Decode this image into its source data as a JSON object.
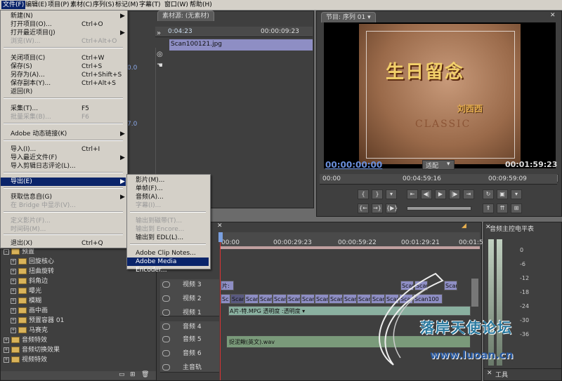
{
  "menubar": {
    "items": [
      "文件(F)",
      "编辑(E)",
      "项目(P)",
      "素材(C)",
      "序列(S)",
      "标记(M)",
      "字幕(T)",
      "窗口(W)",
      "帮助(H)"
    ]
  },
  "file_menu": {
    "items": [
      {
        "label": "新建(N)",
        "shortcut": "",
        "arrow": "▶",
        "disabled": false
      },
      {
        "label": "打开项目(O)...",
        "shortcut": "Ctrl+O",
        "arrow": "",
        "disabled": false
      },
      {
        "label": "打开最近项目(J)",
        "shortcut": "",
        "arrow": "▶",
        "disabled": false
      },
      {
        "label": "浏览(W)...",
        "shortcut": "Ctrl+Alt+O",
        "arrow": "",
        "disabled": true
      },
      {
        "label": "关闭项目(C)",
        "shortcut": "Ctrl+W",
        "arrow": "",
        "disabled": false
      },
      {
        "label": "保存(S)",
        "shortcut": "Ctrl+S",
        "arrow": "",
        "disabled": false
      },
      {
        "label": "另存为(A)...",
        "shortcut": "Ctrl+Shift+S",
        "arrow": "",
        "disabled": false
      },
      {
        "label": "保存副本(Y)...",
        "shortcut": "Ctrl+Alt+S",
        "arrow": "",
        "disabled": false
      },
      {
        "label": "返回(R)",
        "shortcut": "",
        "arrow": "",
        "disabled": false
      },
      {
        "label": "采集(T)...",
        "shortcut": "F5",
        "arrow": "",
        "disabled": false
      },
      {
        "label": "批量采集(B)...",
        "shortcut": "F6",
        "arrow": "",
        "disabled": true
      },
      {
        "label": "Adobe 动态链接(K)",
        "shortcut": "",
        "arrow": "▶",
        "disabled": false
      },
      {
        "label": "导入(I)...",
        "shortcut": "Ctrl+I",
        "arrow": "",
        "disabled": false
      },
      {
        "label": "导入最近文件(F)",
        "shortcut": "",
        "arrow": "▶",
        "disabled": false
      },
      {
        "label": "导入剪辑日志评论(L)...",
        "shortcut": "",
        "arrow": "",
        "disabled": false
      },
      {
        "label": "导出(E)",
        "shortcut": "",
        "arrow": "▶",
        "disabled": false
      },
      {
        "label": "获取信息自(G)",
        "shortcut": "",
        "arrow": "▶",
        "disabled": false
      },
      {
        "label": "在 Bridge 中显示(V)...",
        "shortcut": "",
        "arrow": "",
        "disabled": true
      },
      {
        "label": "定义影片(F)...",
        "shortcut": "",
        "arrow": "",
        "disabled": true
      },
      {
        "label": "时间码(M)...",
        "shortcut": "",
        "arrow": "",
        "disabled": true
      },
      {
        "label": "退出(X)",
        "shortcut": "Ctrl+Q",
        "arrow": "",
        "disabled": false
      }
    ]
  },
  "export_submenu": {
    "items": [
      {
        "label": "影片(M)...",
        "disabled": false
      },
      {
        "label": "单帧(F)...",
        "disabled": false
      },
      {
        "label": "音频(A)...",
        "disabled": false
      },
      {
        "label": "字幕(I)...",
        "disabled": true
      },
      {
        "label": "输出到磁带(T)...",
        "disabled": true
      },
      {
        "label": "输出到 Encore...",
        "disabled": true
      },
      {
        "label": "输出到 EDL(L)...",
        "disabled": false
      },
      {
        "label": "Adobe Clip Notes...",
        "disabled": false
      },
      {
        "label": "Adobe Media Encoder...",
        "disabled": false
      }
    ]
  },
  "source_panel": {
    "tab": "素材源: (无素材)",
    "timecode_start": "0:04:23",
    "timecode_end": "00:00:09:23",
    "clip_name": "Scan100121.jpg",
    "value1": "0.0",
    "value2": "7.0"
  },
  "program_monitor": {
    "tab": "节目: 序列 01",
    "image_title": "生日留念",
    "image_sub": "刘西西",
    "image_classic": "CLASSIC",
    "current_time": "00:00:00:00",
    "fit_label": "适配",
    "duration": "00:01:59:23",
    "ruler_start": "00:00",
    "ruler_mid": "00:04:59:16",
    "ruler_end": "00:09:59:09"
  },
  "effects": {
    "items": [
      {
        "label": "预置",
        "depth": 0,
        "plus": "-"
      },
      {
        "label": "回旋核心",
        "depth": 1,
        "plus": "+"
      },
      {
        "label": "扭曲旋转",
        "depth": 1,
        "plus": "+"
      },
      {
        "label": "斜角边",
        "depth": 1,
        "plus": "+"
      },
      {
        "label": "曝光",
        "depth": 1,
        "plus": "+"
      },
      {
        "label": "模糊",
        "depth": 1,
        "plus": "+"
      },
      {
        "label": "画中画",
        "depth": 1,
        "plus": "+"
      },
      {
        "label": "预置容器 01",
        "depth": 1,
        "plus": "+"
      },
      {
        "label": "马赛克",
        "depth": 1,
        "plus": "+"
      },
      {
        "label": "音频特效",
        "depth": 0,
        "plus": "+"
      },
      {
        "label": "音频切换效果",
        "depth": 0,
        "plus": "+"
      },
      {
        "label": "视频特效",
        "depth": 0,
        "plus": "+"
      }
    ]
  },
  "timeline": {
    "ruler": [
      "00:00",
      "00:00:29:23",
      "00:00:59:22",
      "00:01:29:21",
      "00:01:59:2"
    ],
    "tracks": [
      {
        "name": "视频 3",
        "kind": "video"
      },
      {
        "name": "视频 2",
        "kind": "video"
      },
      {
        "name": "视频 1",
        "kind": "video"
      },
      {
        "name": "音频 4",
        "kind": "audio"
      },
      {
        "name": "音频 5",
        "kind": "audio"
      },
      {
        "name": "音频 6",
        "kind": "audio"
      },
      {
        "name": "主音轨",
        "kind": "audio"
      }
    ],
    "v3_clips": [
      "片:",
      "Scar",
      "Scar",
      "Scar"
    ],
    "v2_clips": [
      "Sc",
      "Scar",
      "Scar",
      "Scar",
      "Scar",
      "Scar",
      "Scar",
      "Scar",
      "Scar",
      "Scar",
      "Scar",
      "Scar",
      "Scar",
      "Scar",
      "Scan100"
    ],
    "v1_clip": "A片-特.MPG 透明度 :透明度 ▾",
    "a5_clip": "捉泥鳅(英文).wav"
  },
  "audio_master": {
    "title": "音频主控电平表",
    "scale": [
      "0",
      "-6",
      "-12",
      "-18",
      "-24",
      "-30",
      "-36"
    ]
  },
  "tools_panel": {
    "title": "工具"
  },
  "watermark": {
    "site": "www.luoan.cn",
    "brand": "落岸天使论坛"
  },
  "colors": {
    "menu_bg": "#d4d0c8",
    "selection": "#0a246a",
    "timecode_blue": "#6a8fdc",
    "video_clip": "#8e8ec4",
    "audio_clip": "#7a9a7a"
  }
}
